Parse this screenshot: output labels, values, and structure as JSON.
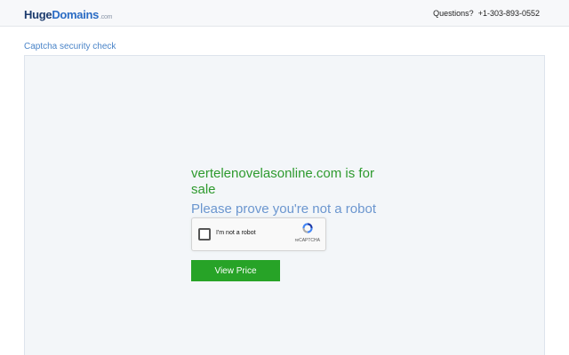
{
  "header": {
    "logo_huge": "Huge",
    "logo_domains": "Domains",
    "logo_tld": ".com",
    "questions_label": "Questions?",
    "phone": "+1-303-893-0552"
  },
  "page": {
    "title": "Captcha security check"
  },
  "main": {
    "domain_heading": "vertelenovelasonline.com is for sale",
    "prove_text": "Please prove you're not a robot",
    "recaptcha": {
      "label": "I'm not a robot",
      "brand": "reCAPTCHA"
    },
    "view_price_label": "View Price"
  },
  "colors": {
    "logo_dark": "#1d3c6e",
    "logo_blue": "#2a6cc4",
    "link_blue": "#4a84c8",
    "heading_green": "#2e9a2e",
    "prove_blue": "#6b96cf",
    "button_green": "#27a327",
    "panel_bg": "#f3f6f9"
  }
}
